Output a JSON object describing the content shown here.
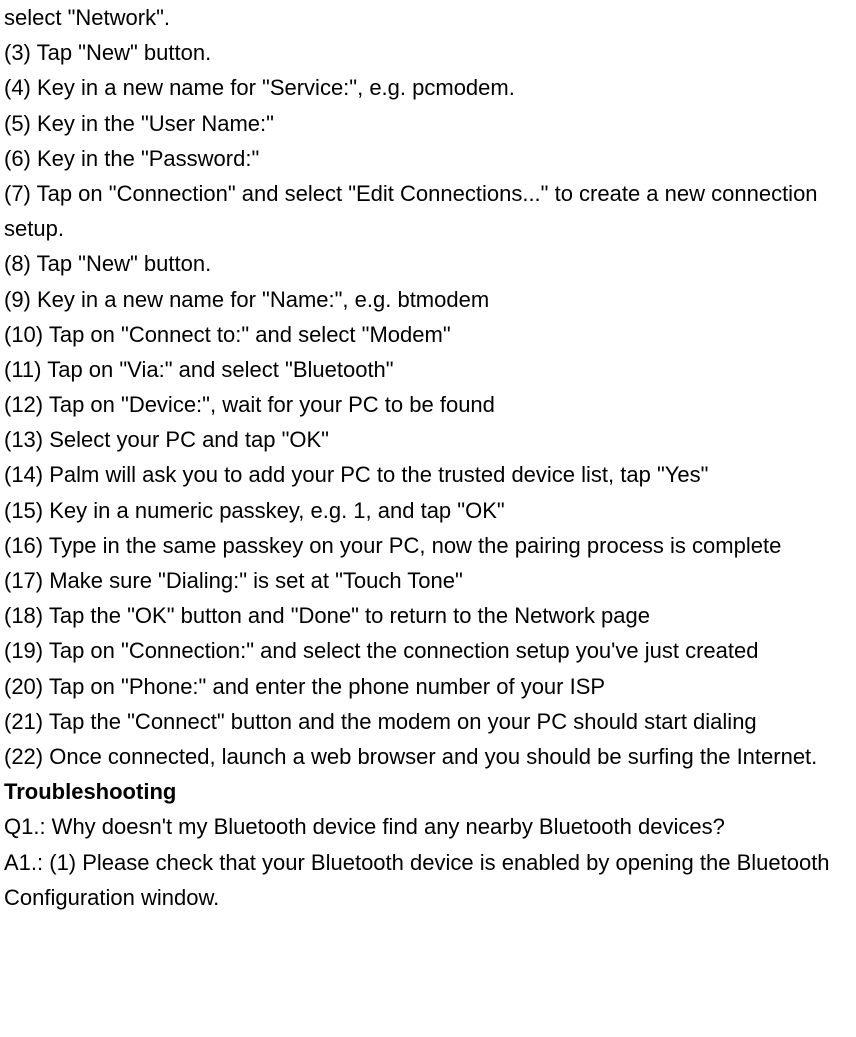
{
  "lines": [
    "select \"Network\".",
    "(3) Tap \"New\" button.",
    "(4) Key in a new name for \"Service:\", e.g. pcmodem.",
    "(5) Key in the \"User Name:\"",
    "(6) Key in the \"Password:\"",
    "(7) Tap on \"Connection\" and select \"Edit Connections...\" to create a new connection setup.",
    "(8) Tap \"New\" button.",
    "(9) Key in a new name for \"Name:\", e.g. btmodem",
    "(10) Tap on \"Connect to:\" and select \"Modem\"",
    "(11) Tap on \"Via:\" and select \"Bluetooth\"",
    "(12) Tap on \"Device:\", wait for your PC to be found",
    "(13) Select your PC and tap \"OK\"",
    "(14) Palm will ask you to add your PC to the trusted device list, tap \"Yes\"",
    "(15) Key in a numeric passkey, e.g. 1, and tap \"OK\"",
    "(16) Type in the same passkey on your PC, now the pairing process is complete",
    "(17) Make sure \"Dialing:\" is set at \"Touch Tone\"",
    "(18) Tap the \"OK\" button and \"Done\" to return to the Network page",
    "(19) Tap on \"Connection:\" and select the connection setup you've just created",
    "(20) Tap on \"Phone:\" and enter the phone number of your ISP",
    "(21) Tap the \"Connect\" button and the modem on your PC should start dialing",
    "(22) Once connected, launch a web browser and you should be surfing the Internet."
  ],
  "heading": "Troubleshooting",
  "qa": [
    "Q1.: Why doesn't my Bluetooth device find any nearby Bluetooth devices?",
    "A1.: (1) Please check that your Bluetooth device is enabled by opening the Bluetooth Configuration window."
  ]
}
